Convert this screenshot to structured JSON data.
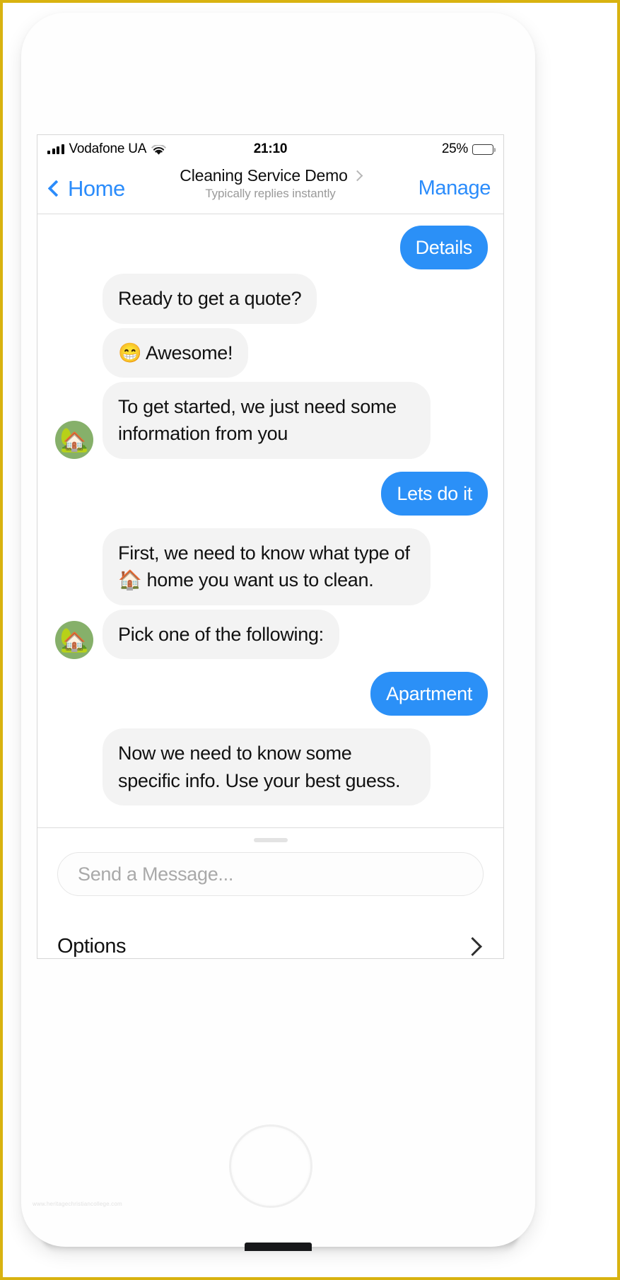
{
  "status_bar": {
    "carrier": "Vodafone UA",
    "time": "21:10",
    "battery_percent": "25%",
    "battery_level": 25,
    "wifi_icon": "wifi-icon",
    "signal_icon": "signal-bars-icon"
  },
  "nav_bar": {
    "back_label": "Home",
    "title": "Cleaning Service Demo",
    "subtitle": "Typically replies instantly",
    "right_action": "Manage",
    "accent_color": "#2b8cfb"
  },
  "thread": {
    "avatar_emoji": "🏡",
    "messages": [
      {
        "side": "out",
        "text": "Details"
      },
      {
        "side": "in",
        "text": "Ready to get a quote?"
      },
      {
        "side": "in",
        "text": "😁 Awesome!"
      },
      {
        "side": "in",
        "text": "To get started, we just need some information from you",
        "avatar": true
      },
      {
        "side": "out",
        "text": "Lets do it"
      },
      {
        "side": "in",
        "text": "First, we need to know what type of 🏠 home you want us to clean."
      },
      {
        "side": "in",
        "text": "Pick one of the following:",
        "avatar": true
      },
      {
        "side": "out",
        "text": "Apartment"
      },
      {
        "side": "in",
        "text": "Now we need to know some specific info. Use your best guess."
      }
    ]
  },
  "composer": {
    "placeholder": "Send a Message...",
    "value": ""
  },
  "options_strip": {
    "label": "Options",
    "chevron_icon": "chevron-up-icon"
  },
  "watermark": {
    "text": "www.heritagechristiancollege.com"
  },
  "colors": {
    "bubble_out": "#2b90f7",
    "bubble_in": "#f3f3f3",
    "accent": "#2b8cfb",
    "avatar_bg": "#86b06a",
    "page_border": "#d9b310"
  }
}
